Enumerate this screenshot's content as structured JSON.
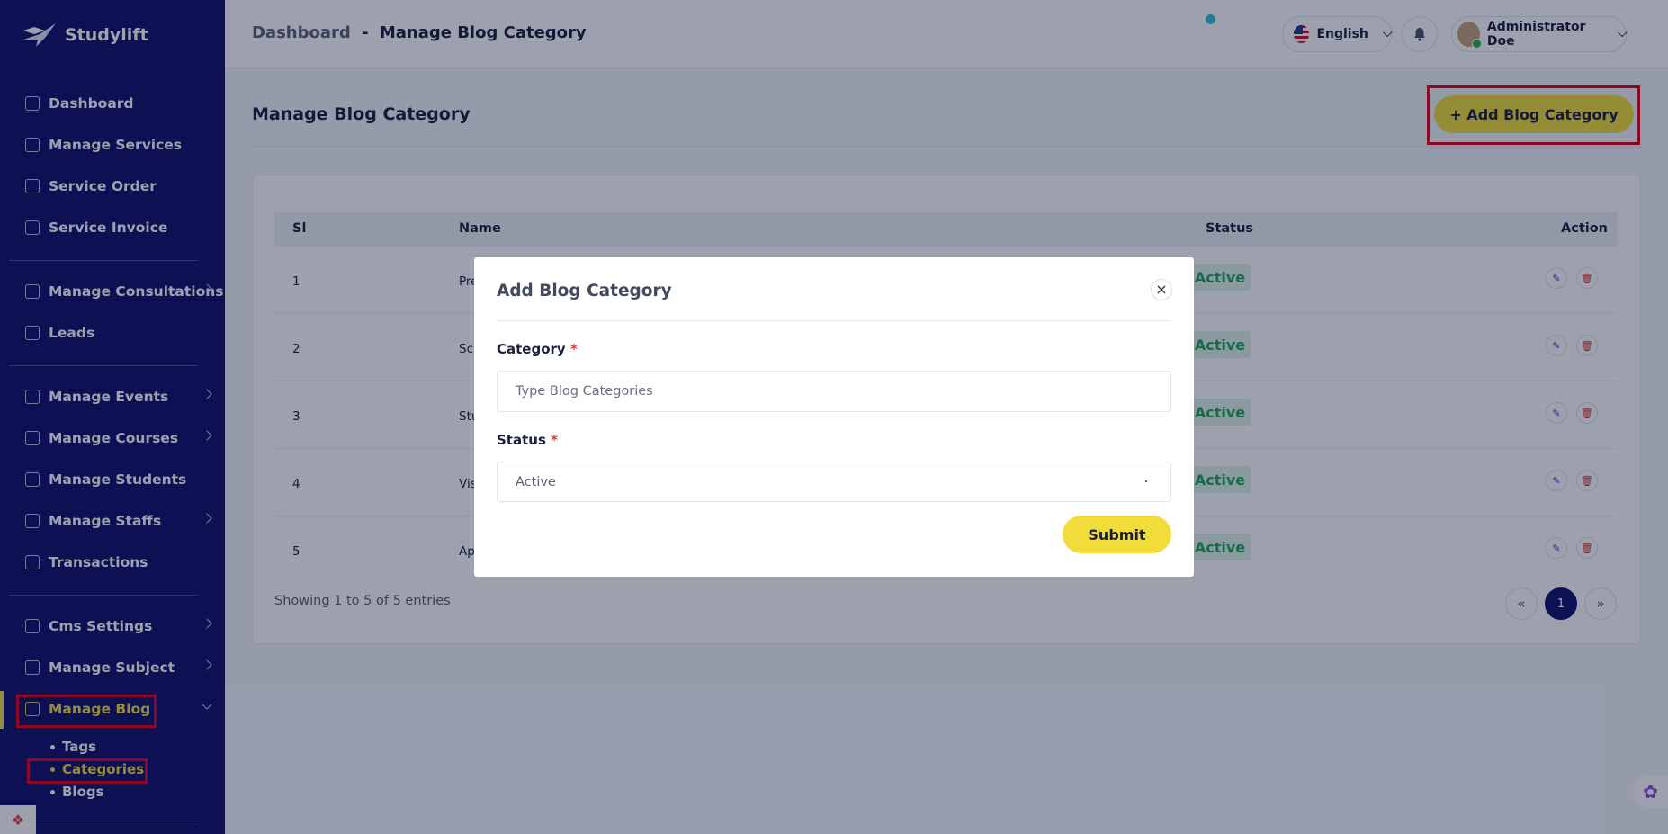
{
  "brand": {
    "name": "Studylift"
  },
  "sidebar": {
    "items": [
      {
        "label": "Dashboard"
      },
      {
        "label": "Manage Services"
      },
      {
        "label": "Service Order"
      },
      {
        "label": "Service Invoice"
      },
      {
        "label": "Manage Consultations"
      },
      {
        "label": "Leads"
      },
      {
        "label": "Manage Events"
      },
      {
        "label": "Manage Courses"
      },
      {
        "label": "Manage Students"
      },
      {
        "label": "Manage Staffs"
      },
      {
        "label": "Transactions"
      },
      {
        "label": "Cms Settings"
      },
      {
        "label": "Manage Subject"
      },
      {
        "label": "Manage Blog"
      }
    ],
    "blog_sub": [
      "Tags",
      "Categories",
      "Blogs"
    ]
  },
  "header": {
    "crumb_root": "Dashboard",
    "crumb_sep": "-",
    "crumb_current": "Manage Blog Category",
    "language": "English",
    "user_name": "Administrator Doe"
  },
  "page": {
    "title": "Manage Blog Category",
    "add_button": "+ Add Blog Category"
  },
  "table": {
    "columns": [
      "Sl",
      "Name",
      "Status",
      "Action"
    ],
    "rows": [
      {
        "sl": "1",
        "name": "Pre",
        "status": "Active"
      },
      {
        "sl": "2",
        "name": "Sc",
        "status": "Active"
      },
      {
        "sl": "3",
        "name": "Stu",
        "status": "Active"
      },
      {
        "sl": "4",
        "name": "Vis",
        "status": "Active"
      },
      {
        "sl": "5",
        "name": "Ap",
        "status": "Active"
      }
    ],
    "showing": "Showing 1 to 5 of 5 entries",
    "pagination": {
      "prev": "«",
      "current": "1",
      "next": "»"
    }
  },
  "modal": {
    "title": "Add Blog Category",
    "close": "×",
    "category_label": "Category",
    "category_placeholder": "Type Blog Categories",
    "status_label": "Status",
    "status_value": "Active",
    "required_mark": "*",
    "submit": "Submit"
  },
  "colors": {
    "sidebar_bg": "#10106a",
    "accent_yellow": "#f2dc3a",
    "active_green": "#22a55a",
    "highlight_red": "#e3001b"
  }
}
